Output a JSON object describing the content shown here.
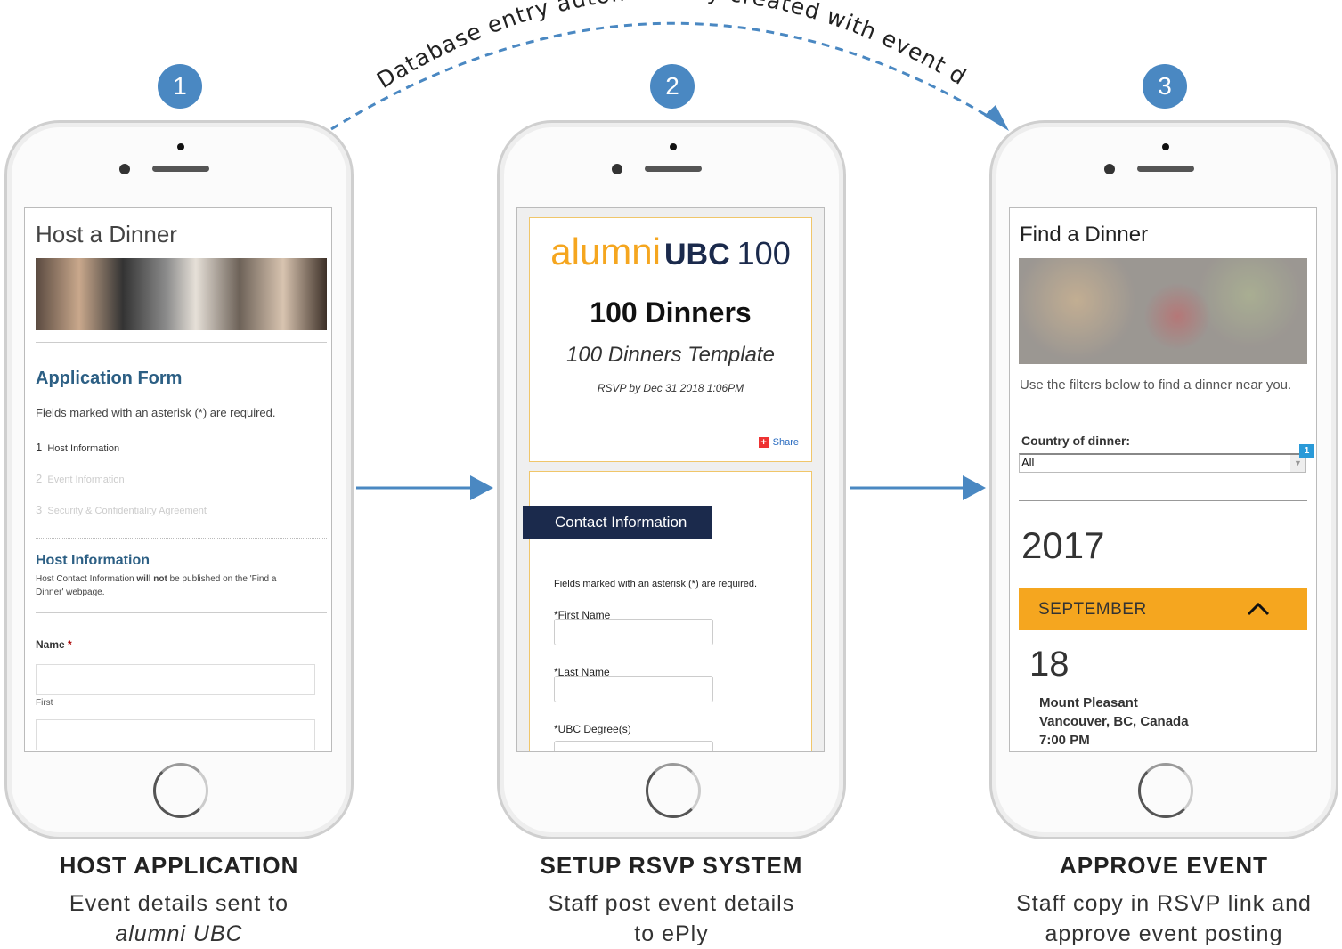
{
  "arc_label": "Database entry automatically created with event details",
  "steps": [
    "1",
    "2",
    "3"
  ],
  "phone1": {
    "title": "Host a Dinner",
    "form_title": "Application Form",
    "required_note": "Fields marked with an asterisk (*) are required.",
    "steps": [
      {
        "num": "1",
        "label": "Host Information"
      },
      {
        "num": "2",
        "label": "Event Information"
      },
      {
        "num": "3",
        "label": "Security & Confidentiality Agreement"
      }
    ],
    "section_title": "Host Information",
    "desc_pre": "Host Contact Information ",
    "desc_bold": "will not",
    "desc_post": " be published on the 'Find a Dinner' webpage.",
    "name_label": "Name",
    "asterisk": "*",
    "first_label": "First"
  },
  "phone2": {
    "logo_alumni": "alumni",
    "logo_ubc": "UBC",
    "logo_100": "100",
    "title": "100 Dinners",
    "subtitle": "100 Dinners Template",
    "rsvp": "RSVP by Dec 31 2018 1:06PM",
    "share": "Share",
    "banner": "Contact Information",
    "required_note": "Fields marked with an asterisk (*) are required.",
    "fields": [
      "*First Name",
      "*Last Name",
      "*UBC Degree(s)"
    ]
  },
  "phone3": {
    "title": "Find a Dinner",
    "intro": "Use the filters below to find a dinner near you.",
    "country_label": "Country of dinner:",
    "country_value": "All",
    "badge": "1",
    "year": "2017",
    "month": "SEPTEMBER",
    "day": "18",
    "location": "Mount Pleasant",
    "city": "Vancouver, BC, Canada",
    "time": "7:00 PM"
  },
  "captions": [
    {
      "title": "HOST APPLICATION",
      "line1": "Event details sent to",
      "line2": "alumni UBC"
    },
    {
      "title": "SETUP RSVP SYSTEM",
      "line1": "Staff post event details",
      "line2": "to ePly"
    },
    {
      "title": "APPROVE EVENT",
      "line1": "Staff copy in RSVP link and",
      "line2": "approve event posting"
    }
  ],
  "colors": {
    "step": "#4a88c2",
    "heading": "#2c5f84",
    "orange": "#f5a61f",
    "navy": "#1b2a4c"
  }
}
